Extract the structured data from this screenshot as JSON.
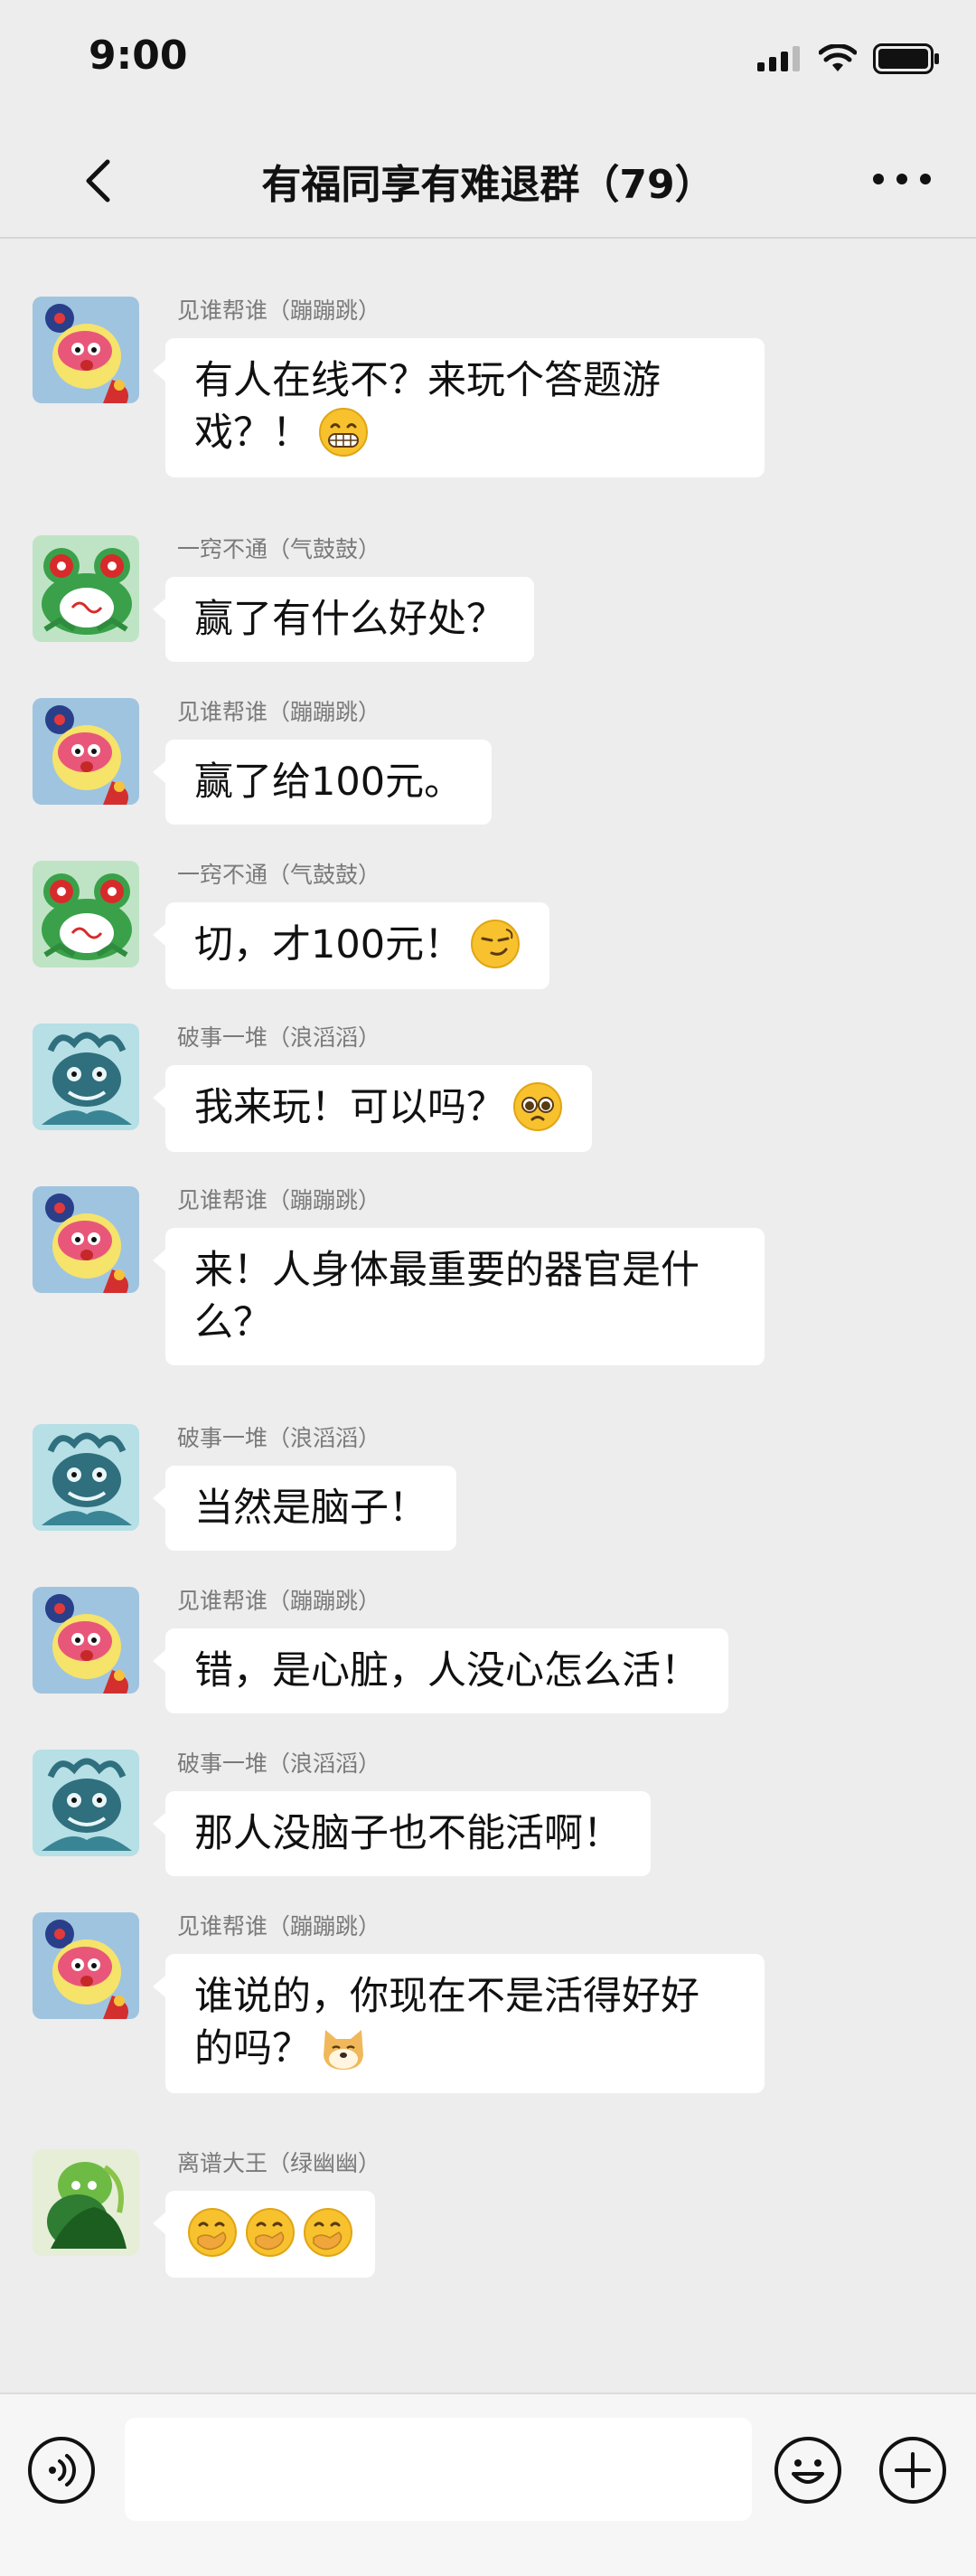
{
  "status_bar": {
    "time": "9:00"
  },
  "header": {
    "title": "有福同享有难退群（79）"
  },
  "messages": [
    {
      "sender": "见谁帮谁（蹦蹦跳）",
      "text": "有人在线不？来玩个答题游戏？！",
      "emoji": "grin-emoji"
    },
    {
      "sender": "一窍不通（气鼓鼓）",
      "text": "赢了有什么好处？"
    },
    {
      "sender": "见谁帮谁（蹦蹦跳）",
      "text": "赢了给100元。"
    },
    {
      "sender": "一窍不通（气鼓鼓）",
      "text": "切，才100元！",
      "emoji": "smirk-emoji"
    },
    {
      "sender": "破事一堆（浪滔滔）",
      "text": "我来玩！可以吗？",
      "emoji": "pleading-emoji"
    },
    {
      "sender": "见谁帮谁（蹦蹦跳）",
      "text": "来！人身体最重要的器官是什么？"
    },
    {
      "sender": "破事一堆（浪滔滔）",
      "text": "当然是脑子！"
    },
    {
      "sender": "见谁帮谁（蹦蹦跳）",
      "text": "错，是心脏，人没心怎么活！"
    },
    {
      "sender": "破事一堆（浪滔滔）",
      "text": "那人没脑子也不能活啊！"
    },
    {
      "sender": "见谁帮谁（蹦蹦跳）",
      "text": "谁说的，你现在不是活得好好的吗？",
      "emoji": "doge-emoji"
    },
    {
      "sender": "离谱大王（绿幽幽）",
      "text": "",
      "emoji": "hand-over-mouth-emoji x3"
    }
  ],
  "input_bar": {
    "placeholder": ""
  },
  "icons": {
    "voice": "voice-icon",
    "emoji": "emoji-icon",
    "plus": "plus-icon",
    "back": "back-chevron-icon",
    "more": "more-icon"
  },
  "colors": {
    "background": "#ededed",
    "bubble": "#ffffff",
    "sender_text": "#7a7a7a",
    "emoji_yellow": "#f7c22e"
  }
}
